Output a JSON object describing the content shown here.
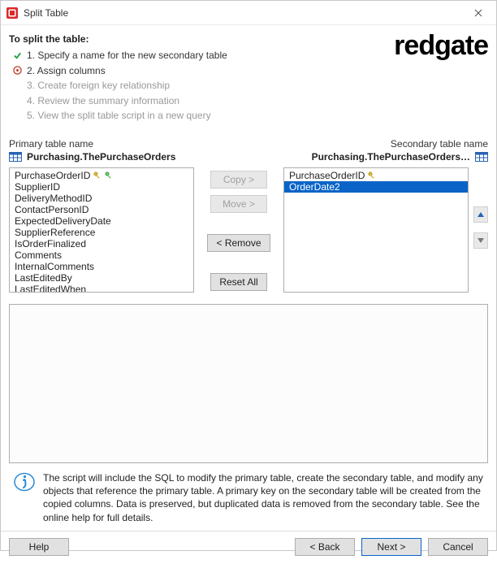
{
  "window": {
    "title": "Split Table"
  },
  "heading": "To split the table:",
  "steps": [
    {
      "label": "1. Specify a name for the new secondary table",
      "state": "done"
    },
    {
      "label": "2. Assign columns",
      "state": "current"
    },
    {
      "label": "3. Create foreign key relationship",
      "state": "disabled"
    },
    {
      "label": "4. Review the summary information",
      "state": "disabled"
    },
    {
      "label": "5. View the split table script in a new query",
      "state": "disabled"
    }
  ],
  "logo": "redgate",
  "labels": {
    "primary_name": "Primary table name",
    "secondary_name": "Secondary table name"
  },
  "primary_table": {
    "name": "Purchasing.ThePurchaseOrders"
  },
  "secondary_table": {
    "name": "Purchasing.ThePurchaseOrders…"
  },
  "primary_columns": [
    {
      "name": "PurchaseOrderID",
      "pk": true
    },
    {
      "name": "SupplierID"
    },
    {
      "name": "DeliveryMethodID"
    },
    {
      "name": "ContactPersonID"
    },
    {
      "name": "ExpectedDeliveryDate"
    },
    {
      "name": "SupplierReference"
    },
    {
      "name": "IsOrderFinalized"
    },
    {
      "name": "Comments"
    },
    {
      "name": "InternalComments"
    },
    {
      "name": "LastEditedBy"
    },
    {
      "name": "LastEditedWhen"
    }
  ],
  "secondary_columns": [
    {
      "name": "PurchaseOrderID",
      "pk": true,
      "selected": false
    },
    {
      "name": "OrderDate2",
      "selected": true
    }
  ],
  "buttons": {
    "copy": "Copy >",
    "move": "Move >",
    "remove": "< Remove",
    "reset": "Reset All",
    "help": "Help",
    "back": "< Back",
    "next": "Next >",
    "cancel": "Cancel"
  },
  "info_text": "The script will include the SQL to modify the primary table, create the secondary table, and modify any objects that reference the primary table. A primary key on the secondary table will be created from the copied columns. Data is preserved, but duplicated data is removed from the secondary table. See the online help for full details.",
  "colors": {
    "accent": "#0a64c8"
  }
}
